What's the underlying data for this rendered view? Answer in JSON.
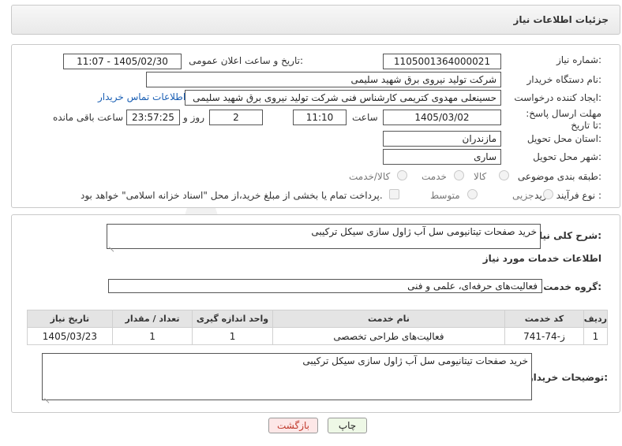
{
  "header": {
    "title": "جزئیات اطلاعات نیاز"
  },
  "fields": {
    "need_number_label": "شماره نیاز:",
    "need_number": "1105001364000021",
    "announce_label": "تاریخ و ساعت اعلان عمومی:",
    "announce_value": "1405/02/30 - 11:07",
    "buyer_org_label": "نام دستگاه خریدار:",
    "buyer_org": "شرکت تولید نیروی برق شهید سلیمی",
    "creator_label": "ایجاد کننده درخواست:",
    "creator": "حسینعلی مهدوی کتریمی کارشناس فنی شرکت تولید نیروی برق شهید سلیمی",
    "contact_link": "اطلاعات تماس خریدار",
    "deadline_label": "مهلت ارسال پاسخ: تا تاریخ:",
    "deadline_date": "1405/03/02",
    "time_label": "ساعت",
    "deadline_time": "11:10",
    "days_value": "2",
    "days_label": "روز و",
    "remaining_time": "23:57:25",
    "remaining_label": "ساعت باقی مانده",
    "province_label": "استان محل تحویل:",
    "province": "مازندران",
    "city_label": "شهر محل تحویل:",
    "city": "ساری",
    "category_label": "طبقه بندی موضوعی:",
    "category_options": [
      "کالا",
      "خدمت",
      "کالا/خدمت"
    ],
    "process_label": "نوع فرآیند خرید :",
    "process_options": [
      "جزیی",
      "متوسط"
    ],
    "payment_note": "پرداخت تمام یا بخشی از مبلغ خرید،از محل \"اسناد خزانه اسلامی\" خواهد بود."
  },
  "description": {
    "label": "شرح کلی نیاز:",
    "value": "خرید صفحات تیتانیومی سل آب ژاول سازی سیکل ترکیبی"
  },
  "services": {
    "section_title": "اطلاعات خدمات مورد نیاز",
    "group_label": "گروه خدمت:",
    "group_value": "فعالیت‌های حرفه‌ای، علمی و فنی",
    "columns": [
      "ردیف",
      "کد خدمت",
      "نام خدمت",
      "واحد اندازه گیری",
      "تعداد / مقدار",
      "تاریخ نیاز"
    ],
    "rows": [
      [
        "1",
        "ز-74-741",
        "فعالیت‌های طراحی تخصصی",
        "1",
        "1",
        "1405/03/23"
      ]
    ]
  },
  "buyer_notes": {
    "label": "توضیحات خریدار:",
    "value": "خرید صفحات تیتانیومی سل آب ژاول سازی سیکل ترکیبی"
  },
  "buttons": {
    "print": "چاپ",
    "back": "بازگشت"
  },
  "watermark": {
    "text": "AriaTender.neT"
  },
  "colors": {
    "link": "#1a5fb4",
    "back_button_bg": "#fde7e7",
    "back_button_text": "#c0392b",
    "print_button_bg": "#eef8e6"
  }
}
